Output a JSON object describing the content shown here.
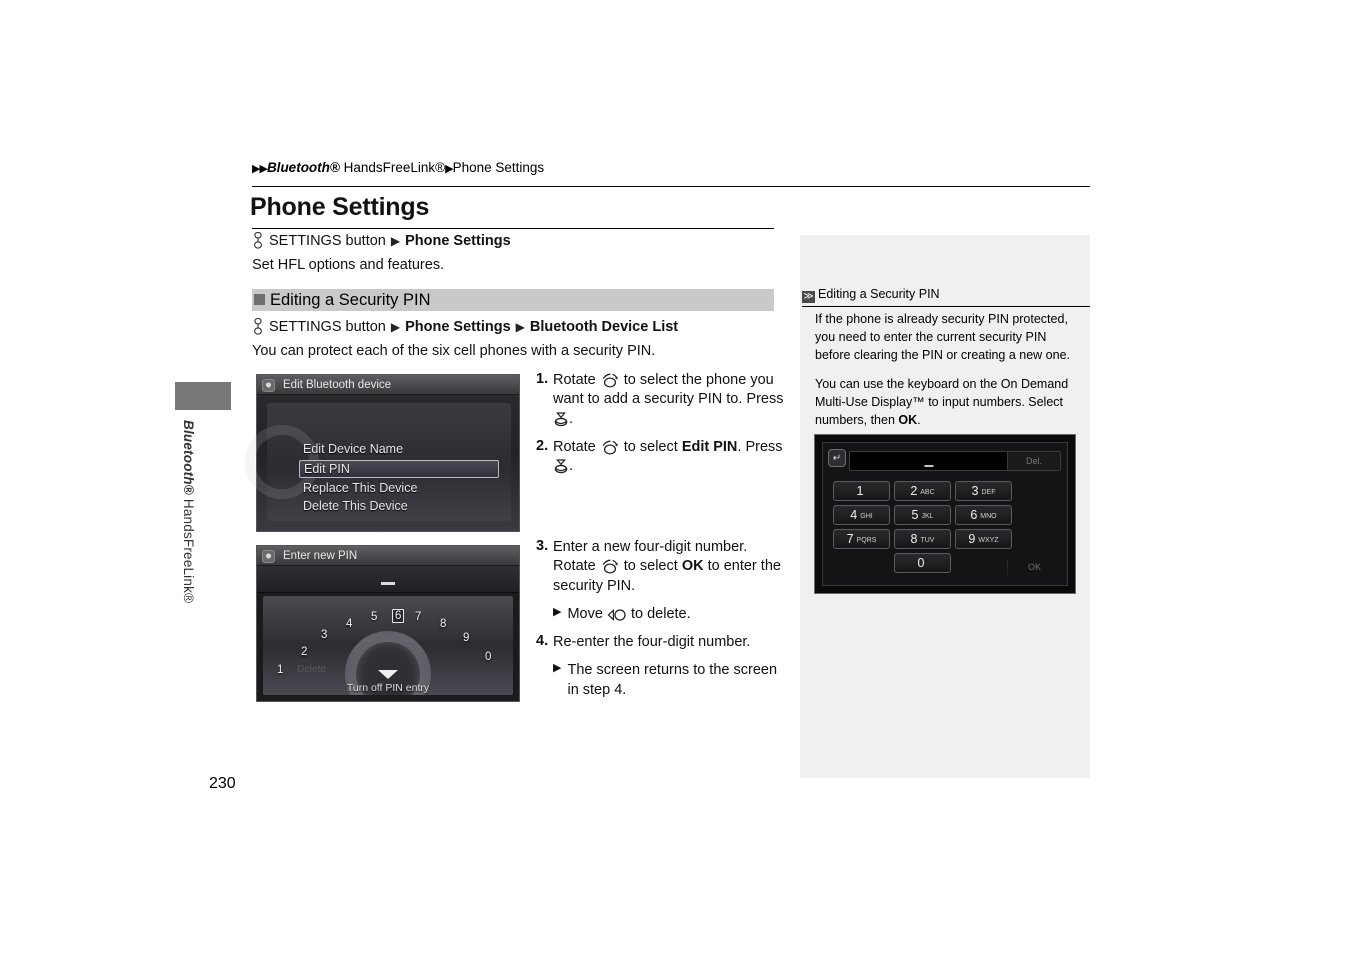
{
  "breadcrumb": {
    "arrow": "▶",
    "part1": "Bluetooth®",
    "part2": " HandsFreeLink®",
    "part3": "Phone Settings"
  },
  "side_tab": {
    "label_italic": "Bluetooth®",
    "label_rest": " HandsFreeLink®"
  },
  "page": {
    "title": "Phone Settings",
    "number": "230"
  },
  "command_top": {
    "icon": "settings-knob-icon",
    "button_text": "SETTINGS button",
    "arrow": "▶",
    "target": "Phone Settings"
  },
  "intro_text": "Set HFL options and features.",
  "section": {
    "bullet": "square-bullet",
    "title": "Editing a Security PIN"
  },
  "command_section": {
    "icon": "settings-knob-icon",
    "button_text": "SETTINGS button",
    "arrow1": "▶",
    "target1": "Phone Settings",
    "arrow2": "▶",
    "target2": "Bluetooth Device List"
  },
  "body_text": "You can protect each of the six cell phones with a security PIN.",
  "screenshot_menu": {
    "title": "Edit Bluetooth device",
    "title_icon": "nav-screen-icon",
    "items": [
      {
        "label": "Edit Device Name",
        "selected": false
      },
      {
        "label": "Edit PIN",
        "selected": true
      },
      {
        "label": "Replace This Device",
        "selected": false
      },
      {
        "label": "Delete This Device",
        "selected": false
      }
    ]
  },
  "screenshot_pin": {
    "title": "Enter new PIN",
    "title_icon": "nav-screen-icon",
    "entry_placeholder": "_",
    "dial_numbers": [
      "1",
      "2",
      "3",
      "4",
      "5",
      "6",
      "7",
      "8",
      "9",
      "0"
    ],
    "selected_number": "6",
    "ghost_label": "Delete",
    "footer_label": "Turn off PIN entry"
  },
  "steps": [
    {
      "num": "1.",
      "segments": [
        {
          "t": "text",
          "v": "Rotate "
        },
        {
          "t": "icon",
          "v": "rotate-knob-icon"
        },
        {
          "t": "text",
          "v": " to select the phone you want to add a security PIN to. Press "
        },
        {
          "t": "icon",
          "v": "press-knob-icon"
        },
        {
          "t": "text",
          "v": "."
        }
      ]
    },
    {
      "num": "2.",
      "segments": [
        {
          "t": "text",
          "v": "Rotate "
        },
        {
          "t": "icon",
          "v": "rotate-knob-icon"
        },
        {
          "t": "text",
          "v": " to select "
        },
        {
          "t": "bold",
          "v": "Edit PIN"
        },
        {
          "t": "text",
          "v": ". Press "
        },
        {
          "t": "icon",
          "v": "press-knob-icon"
        },
        {
          "t": "text",
          "v": "."
        }
      ]
    },
    {
      "num": "3.",
      "segments": [
        {
          "t": "text",
          "v": "Enter a new four-digit number. Rotate "
        },
        {
          "t": "icon",
          "v": "rotate-knob-icon"
        },
        {
          "t": "text",
          "v": " to select "
        },
        {
          "t": "bold",
          "v": "OK"
        },
        {
          "t": "text",
          "v": " to enter the security PIN."
        }
      ],
      "sub": [
        {
          "segments": [
            {
              "t": "text",
              "v": "Move "
            },
            {
              "t": "icon",
              "v": "move-left-knob-icon"
            },
            {
              "t": "text",
              "v": " to delete."
            }
          ]
        }
      ]
    },
    {
      "num": "4.",
      "segments": [
        {
          "t": "text",
          "v": "Re-enter the four-digit number."
        }
      ],
      "sub": [
        {
          "segments": [
            {
              "t": "text",
              "v": "The screen returns to the screen in step 4."
            }
          ]
        }
      ]
    }
  ],
  "sidebar": {
    "head_icon": "≫",
    "head_title": "Editing a Security PIN",
    "paragraph1": "If the phone is already security PIN protected, you need to enter the current security PIN before clearing the PIN or creating a new one.",
    "paragraph2_a": "You can use the keyboard on the On Demand Multi-Use Display™ to input numbers. Select numbers, then ",
    "paragraph2_b": "OK",
    "paragraph2_c": ".",
    "keypad": {
      "back_icon": "return-icon",
      "display_value": "_",
      "delete_label": "Del.",
      "ok_label": "OK",
      "keys": [
        {
          "digit": "1",
          "letters": ""
        },
        {
          "digit": "2",
          "letters": "ABC"
        },
        {
          "digit": "3",
          "letters": "DEF"
        },
        {
          "digit": "4",
          "letters": "GHI"
        },
        {
          "digit": "5",
          "letters": "JKL"
        },
        {
          "digit": "6",
          "letters": "MNO"
        },
        {
          "digit": "7",
          "letters": "PQRS"
        },
        {
          "digit": "8",
          "letters": "TUV"
        },
        {
          "digit": "9",
          "letters": "WXYZ"
        },
        {
          "digit": "0",
          "letters": ""
        }
      ]
    }
  },
  "colors": {
    "section_band": "#c9c9c9",
    "sidebar_bg": "#f0f0f0",
    "side_tab": "#777777",
    "bullet": "#6f6f6f"
  }
}
